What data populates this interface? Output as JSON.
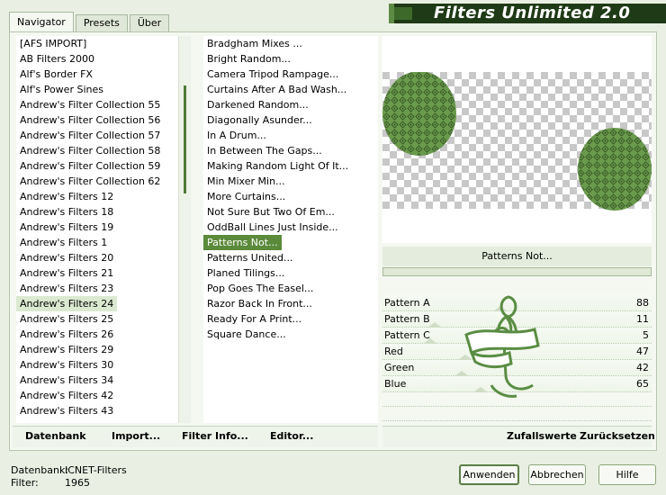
{
  "tabs": [
    "Navigator",
    "Presets",
    "Über"
  ],
  "title": "Filters Unlimited 2.0",
  "categories": [
    "[AFS IMPORT]",
    "AB Filters 2000",
    "Alf's Border FX",
    "Alf's Power Sines",
    "Andrew's Filter Collection 55",
    "Andrew's Filter Collection 56",
    "Andrew's Filter Collection 57",
    "Andrew's Filter Collection 58",
    "Andrew's Filter Collection 59",
    "Andrew's Filter Collection 62",
    "Andrew's Filters 12",
    "Andrew's Filters 18",
    "Andrew's Filters 19",
    "Andrew's Filters 1",
    "Andrew's Filters 20",
    "Andrew's Filters 21",
    "Andrew's Filters 23",
    "Andrew's Filters 24",
    "Andrew's Filters 25",
    "Andrew's Filters 26",
    "Andrew's Filters 29",
    "Andrew's Filters 30",
    "Andrew's Filters 34",
    "Andrew's Filters 42",
    "Andrew's Filters 43"
  ],
  "selected_category": "Andrew's Filters 24",
  "filters": [
    "Bradgham Mixes ...",
    "Bright Random...",
    "Camera Tripod Rampage...",
    "Curtains After A Bad Wash...",
    "Darkened Random...",
    "Diagonally Asunder...",
    "In A Drum...",
    "In Between The Gaps...",
    "Making Random Light Of It...",
    "Min Mixer Min...",
    "More Curtains...",
    "Not Sure But Two Of Em...",
    "OddBall Lines Just Inside...",
    "Patterns Not...",
    "Patterns United...",
    "Planed Tilings...",
    "Pop Goes The Easel...",
    "Razor Back In Front...",
    "Ready For A Print...",
    "Square Dance..."
  ],
  "selected_filter": "Patterns Not...",
  "current_filter_label": "Patterns Not...",
  "params": [
    {
      "name": "Pattern A",
      "value": "88"
    },
    {
      "name": "Pattern B",
      "value": "11"
    },
    {
      "name": "Pattern C",
      "value": "5"
    },
    {
      "name": "Red",
      "value": "47"
    },
    {
      "name": "Green",
      "value": "42"
    },
    {
      "name": "Blue",
      "value": "65"
    }
  ],
  "buttons": {
    "database": "Datenbank",
    "import": "Import...",
    "filter_info": "Filter Info...",
    "editor": "Editor...",
    "randomize": "Zufallswerte",
    "reset": "Zurücksetzen",
    "apply": "Anwenden",
    "cancel": "Abbrechen",
    "help": "Hilfe"
  },
  "status": {
    "database_label": "Datenbank:",
    "database_value": "ICNET-Filters",
    "filter_label": "Filter:",
    "filter_value": "1965"
  },
  "colors": {
    "accent": "#5b8a3a",
    "dark_green": "#1f3a16",
    "background": "#e9f0e3"
  }
}
